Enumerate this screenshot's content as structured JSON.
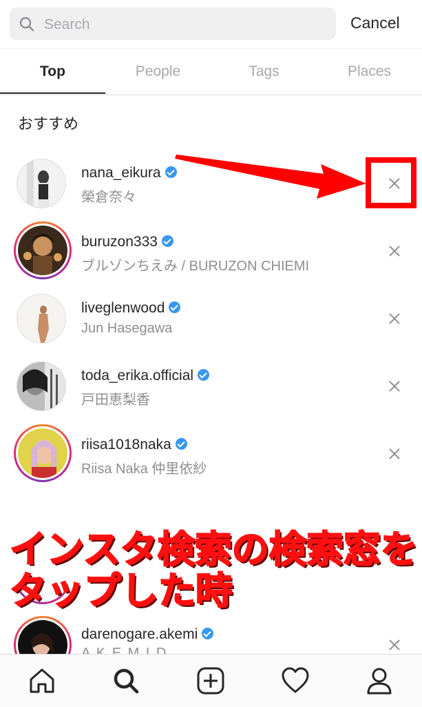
{
  "search": {
    "placeholder": "Search",
    "cancel_label": "Cancel"
  },
  "tabs": [
    {
      "label": "Top",
      "active": true
    },
    {
      "label": "People",
      "active": false
    },
    {
      "label": "Tags",
      "active": false
    },
    {
      "label": "Places",
      "active": false
    }
  ],
  "section_title": "おすすめ",
  "suggestions": [
    {
      "username": "nana_eikura",
      "subtitle": "榮倉奈々",
      "verified": true
    },
    {
      "username": "buruzon333",
      "subtitle": "ブルゾンちえみ / BURUZON CHIEMI",
      "verified": true
    },
    {
      "username": "liveglenwood",
      "subtitle": "Jun Hasegawa",
      "verified": true
    },
    {
      "username": "toda_erika.official",
      "subtitle": "戸田恵梨香",
      "verified": true
    },
    {
      "username": "riisa1018naka",
      "subtitle": "Riisa Naka  仲里依紗",
      "verified": true
    },
    {
      "username": "darenogare.akemi",
      "subtitle": "A K E M I  D",
      "verified": true
    }
  ],
  "annotation": {
    "caption_line1": "インスタ検索の検索窓を",
    "caption_line2": "タップした時",
    "color": "#ff0000"
  },
  "bottom_nav": [
    {
      "icon": "home-icon"
    },
    {
      "icon": "search-icon"
    },
    {
      "icon": "add-post-icon"
    },
    {
      "icon": "heart-icon"
    },
    {
      "icon": "profile-icon"
    }
  ],
  "colors": {
    "verified": "#3897f0",
    "secondary_text": "#8e8e8e",
    "story_ring": "#dd2a7b"
  }
}
